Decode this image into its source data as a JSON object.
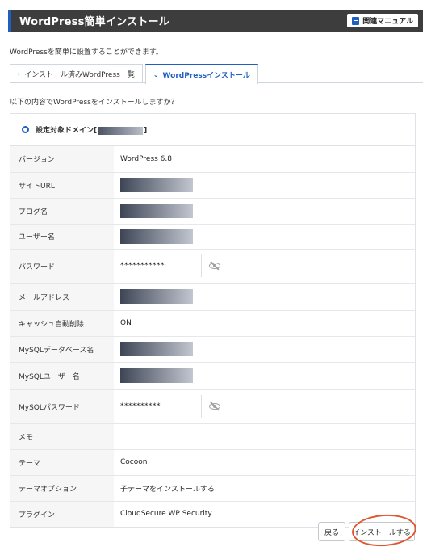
{
  "header": {
    "title": "WordPress簡単インストール",
    "manual_label": "関連マニュアル"
  },
  "intro": "WordPressを簡単に設置することができます。",
  "tabs": [
    {
      "label": "インストール済みWordPress一覧",
      "icon": "chevron-right-icon",
      "active": false
    },
    {
      "label": "WordPressインストール",
      "icon": "chevron-down-icon",
      "active": true
    }
  ],
  "question": "以下の内容でWordPressをインストールしますか？",
  "domain": {
    "prefix": "設定対象ドメイン[",
    "suffix": "]"
  },
  "rows": {
    "version": {
      "label": "バージョン",
      "value": "WordPress 6.8"
    },
    "site_url": {
      "label": "サイトURL"
    },
    "blog_name": {
      "label": "ブログ名"
    },
    "user_name": {
      "label": "ユーザー名"
    },
    "password": {
      "label": "パスワード",
      "value": "***********"
    },
    "email": {
      "label": "メールアドレス"
    },
    "cache": {
      "label": "キャッシュ自動削除",
      "value": "ON"
    },
    "db_name": {
      "label": "MySQLデータベース名"
    },
    "db_user": {
      "label": "MySQLユーザー名"
    },
    "db_password": {
      "label": "MySQLパスワード",
      "value": "**********"
    },
    "memo": {
      "label": "メモ",
      "value": ""
    },
    "theme": {
      "label": "テーマ",
      "value": "Cocoon"
    },
    "theme_option": {
      "label": "テーマオプション",
      "value": "子テーマをインストールする"
    },
    "plugin": {
      "label": "プラグイン",
      "value": "CloudSecure WP Security"
    }
  },
  "buttons": {
    "back": "戻る",
    "install": "インストールする"
  },
  "colors": {
    "accent": "#1f5fbf",
    "header_bg": "#3d3d3d",
    "annotation": "#e0562e"
  }
}
